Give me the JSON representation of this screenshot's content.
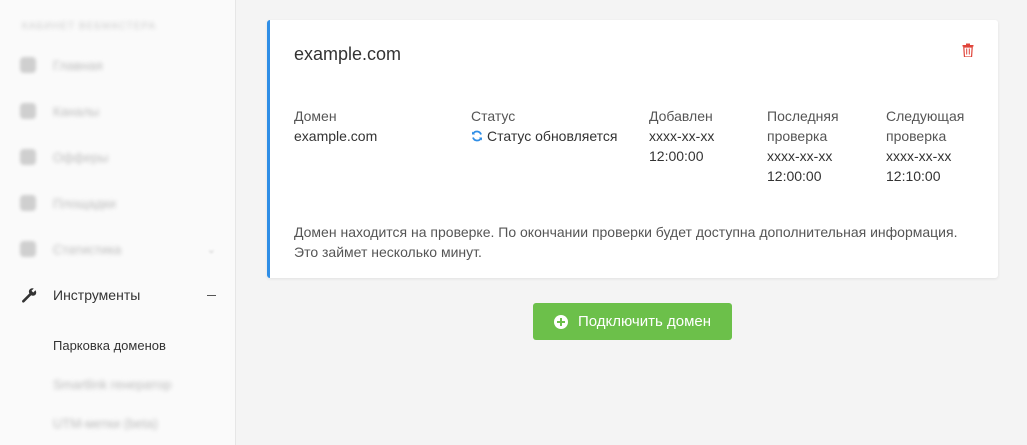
{
  "sidebar": {
    "header": "кабинет вебмастера",
    "items": [
      {
        "label": "Главная"
      },
      {
        "label": "Каналы"
      },
      {
        "label": "Офферы"
      },
      {
        "label": "Площадки"
      },
      {
        "label": "Статистика"
      },
      {
        "label": "Инструменты"
      }
    ],
    "subitems": [
      {
        "label": "Парковка доменов"
      },
      {
        "label": "Smartlink генератор"
      },
      {
        "label": "UTM-метки (beta)"
      }
    ]
  },
  "card": {
    "title": "example.com",
    "columns": {
      "domain": {
        "head": "Домен",
        "value": "example.com"
      },
      "status": {
        "head": "Статус",
        "value": "Статус обновляется"
      },
      "added": {
        "head": "Добавлен",
        "value": "xxxx-xx-xx\n12:00:00"
      },
      "last_check": {
        "head": "Последняя\nпроверка",
        "value": "xxxx-xx-xx\n12:00:00"
      },
      "next_check": {
        "head": "Следующая\nпроверка",
        "value": "xxxx-xx-xx\n12:10:00"
      }
    },
    "note": "Домен находится на проверке. По окончании проверки будет доступна дополнительная информация. Это займет несколько минут."
  },
  "actions": {
    "connect_domain": "Подключить домен"
  },
  "colors": {
    "accent": "#2f8ee6",
    "button": "#6cc04a",
    "danger": "#e0443a"
  }
}
